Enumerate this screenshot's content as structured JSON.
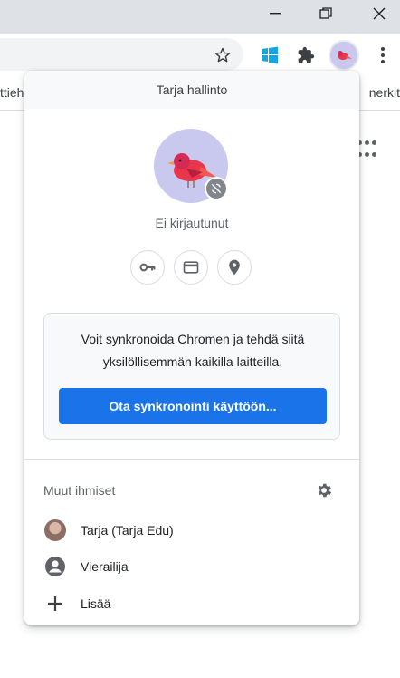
{
  "browser": {
    "window_controls": {
      "minimize": "—",
      "restore": "❐",
      "close": "✕"
    },
    "toolbar_icons": [
      "star-icon",
      "windows-extension-icon",
      "extensions-puzzle-icon",
      "profile-avatar-icon",
      "more-vert-icon"
    ],
    "bookmarks": {
      "left_partial": "ttieh",
      "right_partial": "nerkit"
    }
  },
  "profile_menu": {
    "header": "Tarja hallinto",
    "status": "Ei kirjautunut",
    "quick_icons": [
      "key-icon",
      "credit-card-icon",
      "location-pin-icon"
    ],
    "sync_card": {
      "text": "Voit synkronoida Chromen ja tehdä siitä yksilöllisemmän kaikilla laitteilla.",
      "button": "Ota synkronointi käyttöön..."
    },
    "others": {
      "title": "Muut ihmiset",
      "items": [
        {
          "label": "Tarja (Tarja Edu)",
          "icon": "person-photo-icon"
        },
        {
          "label": "Vierailija",
          "icon": "guest-account-icon"
        },
        {
          "label": "Lisää",
          "icon": "plus-icon"
        }
      ]
    }
  },
  "colors": {
    "accent": "#1a73e8",
    "titlebar": "#dee1e6",
    "avatar_bg": "#c9c8ef"
  }
}
